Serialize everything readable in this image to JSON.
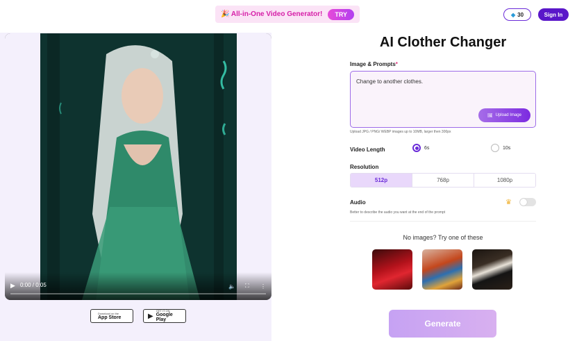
{
  "header": {
    "banner_text": "🎉 All-in-One Video Generator!",
    "try_label": "TRY",
    "credits": "30",
    "signin_label": "Sign In"
  },
  "video": {
    "time": "0:00 / 0:05"
  },
  "stores": {
    "appstore_small": "Download on the",
    "appstore_large": "App Store",
    "gplay_small": "GET IT ON",
    "gplay_large": "Google Play"
  },
  "form": {
    "title": "AI Clother Changer",
    "prompt_label": "Image & Prompts",
    "prompt_required": "*",
    "prompt_value": "Change to another clothes.",
    "upload_label": "Upload Image",
    "upload_hint": "Upload JPG / PNG/ WEBP images up to 10MB, larger then 300px",
    "length_label": "Video Length",
    "length_options": [
      "6s",
      "10s"
    ],
    "length_selected": "6s",
    "resolution_label": "Resolution",
    "resolution_options": [
      "512p",
      "768p",
      "1080p"
    ],
    "resolution_selected": "512p",
    "audio_label": "Audio",
    "audio_hint": "Better to describe the audio you want at the end of the prompt",
    "audio_enabled": false,
    "examples_title": "No images? Try one of these",
    "generate_label": "Generate"
  },
  "colors": {
    "accent": "#6a2bd8",
    "banner_bg": "#fbe3f6"
  }
}
